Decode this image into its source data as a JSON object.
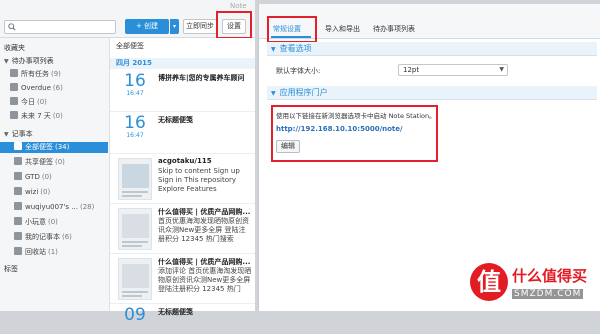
{
  "app": {
    "window_title": "Note",
    "search": {
      "placeholder": ""
    },
    "toolbar": {
      "create_label": "+ 创建",
      "sync_label": "立即同步",
      "settings_label": "设置"
    }
  },
  "sidebar": {
    "favorites": "收藏夹",
    "todo_header": "待办事项列表",
    "todo_items": [
      {
        "label": "所有任务",
        "count": "(9)"
      },
      {
        "label": "Overdue",
        "count": "(6)"
      },
      {
        "label": "今日",
        "count": "(0)"
      },
      {
        "label": "未来 7 天",
        "count": "(0)"
      }
    ],
    "notebook_header": "记事本",
    "notebook_items": [
      {
        "label": "全部便签",
        "count": "(34)"
      },
      {
        "label": "共享便签",
        "count": "(0)"
      },
      {
        "label": "GTD",
        "count": "(0)"
      },
      {
        "label": "wizi",
        "count": "(0)"
      },
      {
        "label": "wuqiyu007's ...",
        "count": "(28)"
      },
      {
        "label": "小玩意",
        "count": "(0)"
      },
      {
        "label": "我的记事本",
        "count": "(6)"
      },
      {
        "label": "回收站",
        "count": "(1)"
      }
    ],
    "tags_header": "标签"
  },
  "notelist": {
    "header": "全部便签",
    "month": "四月 2015",
    "notes": [
      {
        "day": "16",
        "time": "16:47",
        "title": "博拼养车|您的专属养车顾问",
        "body": ""
      },
      {
        "day": "16",
        "time": "16:47",
        "title": "无标题便笺",
        "body": ""
      },
      {
        "day": "",
        "time": "",
        "title": "acgotaku/115",
        "body": "Skip to content Sign up Sign in This repository Explore Features Enterprise Blog"
      },
      {
        "day": "",
        "time": "",
        "title": "什么值得买 | 优质产品网购...",
        "body": "首页优惠海淘发现晒物原创资讯众测New更多全屏 登陆注册积分 12345 热门搜索"
      },
      {
        "day": "",
        "time": "",
        "title": "什么值得买 | 优质产品网购...",
        "body": "添加评论 首页优惠海淘发现晒物原创资讯众测New更多全屏 登陆注册积分 12345 热门"
      },
      {
        "day": "09",
        "time": "",
        "title": "无标题便笺",
        "body": ""
      }
    ]
  },
  "settings": {
    "tabs": [
      "常规设置",
      "导入和导出",
      "待办事项列表"
    ],
    "view_section": "查看选项",
    "font_size_label": "默认字体大小:",
    "font_size_value": "12pt",
    "portal_section": "应用程序门户",
    "portal_desc": "使用以下链接在新浏览器选项卡中启动 Note Station。",
    "portal_link": "http://192.168.10.10:5000/note/",
    "edit_button": "编辑"
  },
  "watermark": {
    "text": "什么值得买",
    "sub": "SMZDM.COM",
    "mark": "值"
  },
  "colors": {
    "accent": "#2a8fd8",
    "highlight": "#e2202e"
  }
}
